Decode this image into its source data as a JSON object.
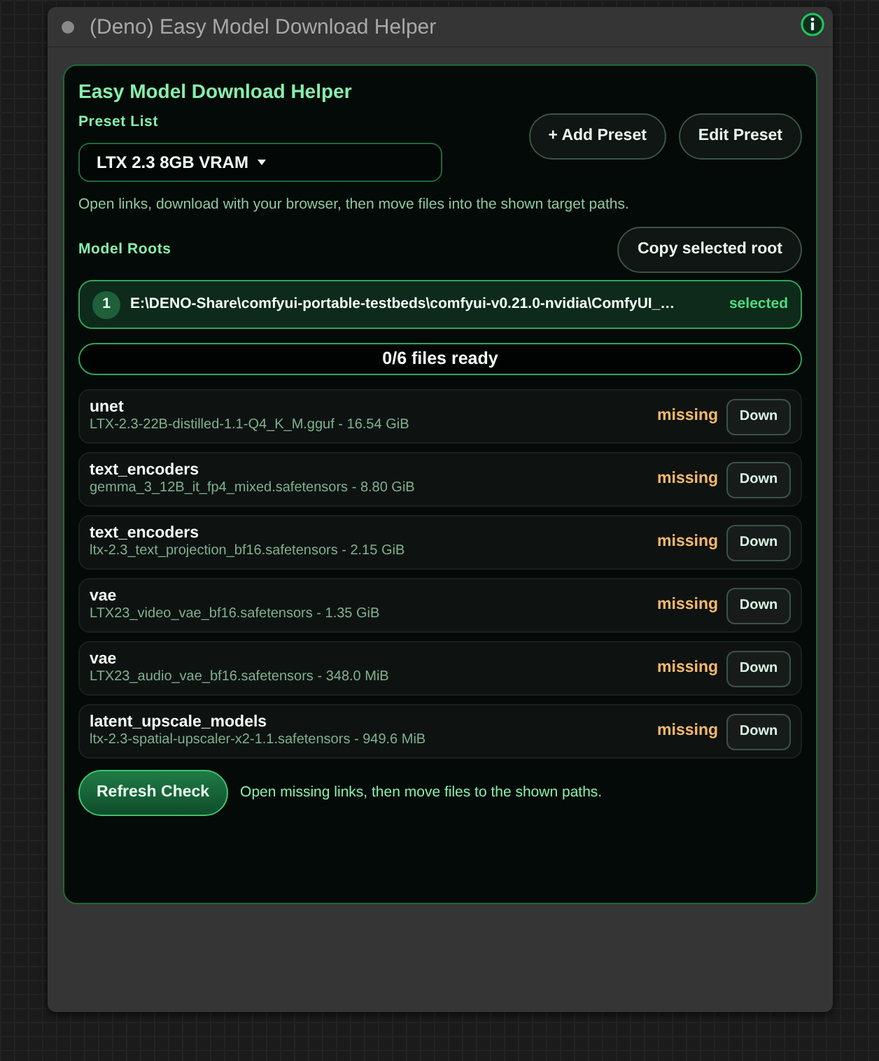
{
  "node": {
    "title": "(Deno) Easy Model Download Helper"
  },
  "panel": {
    "title": "Easy Model Download Helper",
    "preset_label": "Preset List",
    "preset_select": {
      "value": "LTX 2.3 8GB VRAM"
    },
    "buttons": [
      "+ Add Preset",
      "Edit Preset"
    ],
    "description": "Open links, download with your browser, then move files into the shown target paths."
  },
  "model_roots": {
    "label": "Model Roots",
    "copy_button": "Copy selected root",
    "roots": [
      {
        "index": "1",
        "path": "E:\\DENO-Share\\comfyui-portable-testbeds\\comfyui-v0.21.0-nvidia\\ComfyUI_…",
        "badge": "selected",
        "selected": true
      }
    ]
  },
  "ready_summary": {
    "label": "0/6 files ready"
  },
  "files": [
    {
      "folder": "unet",
      "file": "LTX-2.3-22B-distilled-1.1-Q4_K_M.gguf - 16.54 GiB",
      "status": "missing",
      "button": "Down"
    },
    {
      "folder": "text_encoders",
      "file": "gemma_3_12B_it_fp4_mixed.safetensors - 8.80 GiB",
      "status": "missing",
      "button": "Down"
    },
    {
      "folder": "text_encoders",
      "file": "ltx-2.3_text_projection_bf16.safetensors - 2.15 GiB",
      "status": "missing",
      "button": "Down"
    },
    {
      "folder": "vae",
      "file": "LTX23_video_vae_bf16.safetensors - 1.35 GiB",
      "status": "missing",
      "button": "Down"
    },
    {
      "folder": "vae",
      "file": "LTX23_audio_vae_bf16.safetensors - 348.0 MiB",
      "status": "missing",
      "button": "Down"
    },
    {
      "folder": "latent_upscale_models",
      "file": "ltx-2.3-spatial-upscaler-x2-1.1.safetensors - 949.6 MiB",
      "status": "missing",
      "button": "Down"
    }
  ],
  "footer": {
    "button": "Refresh Check",
    "hint": "Open missing links, then move files to the shown paths."
  }
}
